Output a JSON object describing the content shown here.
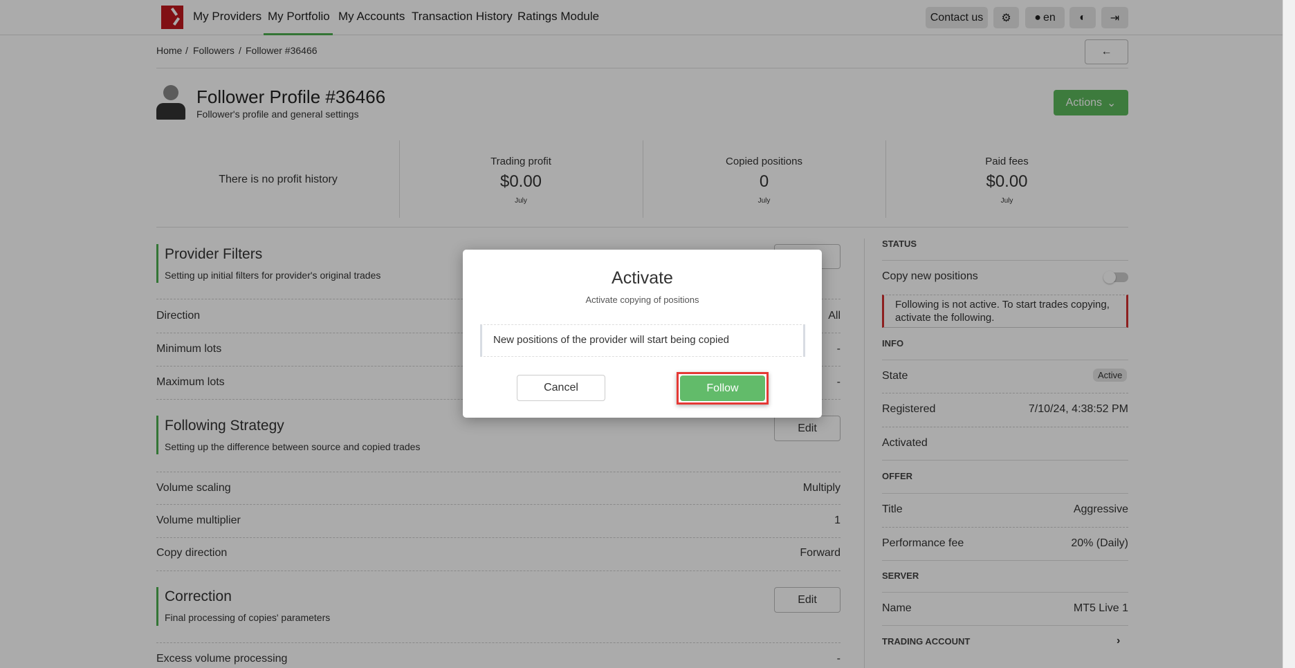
{
  "nav": {
    "items": [
      "My Providers",
      "My Portfolio",
      "My Accounts",
      "Transaction History",
      "Ratings Module"
    ],
    "active": "My Portfolio",
    "contact": "Contact us",
    "lang": "en"
  },
  "breadcrumb": [
    "Home",
    "Followers",
    "Follower #36466"
  ],
  "header": {
    "title": "Follower Profile #36466",
    "subtitle": "Follower's profile and general settings",
    "actions": "Actions"
  },
  "stats": {
    "no_history": "There is no profit history",
    "items": [
      {
        "label": "Trading profit",
        "value": "$0.00",
        "period": "July"
      },
      {
        "label": "Copied positions",
        "value": "0",
        "period": "July"
      },
      {
        "label": "Paid fees",
        "value": "$0.00",
        "period": "July"
      }
    ]
  },
  "filters": {
    "title": "Provider Filters",
    "subtitle": "Setting up initial filters for provider's original trades",
    "edit": "Edit",
    "rows": [
      {
        "label": "Direction",
        "value": "All"
      },
      {
        "label": "Minimum lots",
        "value": "-"
      },
      {
        "label": "Maximum lots",
        "value": "-"
      }
    ]
  },
  "strategy": {
    "title": "Following Strategy",
    "subtitle": "Setting up the difference between source and copied trades",
    "edit": "Edit",
    "rows": [
      {
        "label": "Volume scaling",
        "value": "Multiply"
      },
      {
        "label": "Volume multiplier",
        "value": "1"
      },
      {
        "label": "Copy direction",
        "value": "Forward"
      }
    ]
  },
  "correction": {
    "title": "Correction",
    "subtitle": "Final processing of copies' parameters",
    "edit": "Edit",
    "rows": [
      {
        "label": "Excess volume processing",
        "value": "-"
      }
    ]
  },
  "side": {
    "status": "STATUS",
    "copy_new": "Copy new positions",
    "copy_new_on": false,
    "alert": "Following is not active. To start trades copying, activate the following.",
    "info": "INFO",
    "state_label": "State",
    "state": "Active",
    "registered_label": "Registered",
    "registered": "7/10/24, 4:38:52 PM",
    "activated_label": "Activated",
    "offer": "OFFER",
    "title_label": "Title",
    "title": "Aggressive",
    "fee_label": "Performance fee",
    "fee": "20% (Daily)",
    "server": "SERVER",
    "name_label": "Name",
    "name": "MT5 Live 1",
    "trading_account": "TRADING ACCOUNT"
  },
  "modal": {
    "title": "Activate",
    "subtitle": "Activate copying of positions",
    "message": "New positions of the provider will start being copied",
    "cancel": "Cancel",
    "follow": "Follow"
  },
  "colors": {
    "accent": "#5cb85c",
    "brand": "#c0191e",
    "alert": "#d32f2f"
  }
}
